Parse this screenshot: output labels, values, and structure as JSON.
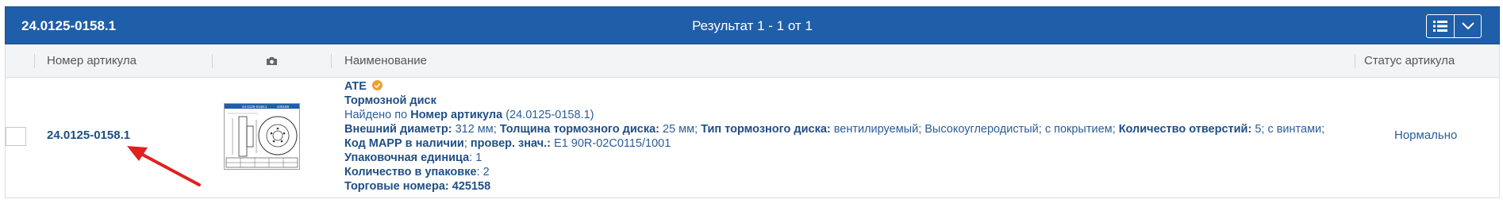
{
  "toolbar": {
    "article": "24.0125-0158.1",
    "result": "Результат 1 - 1 от 1",
    "list_view_icon": "list-icon",
    "toggle_icon": "chevron-down-icon"
  },
  "columns": {
    "article": "Номер артикула",
    "photo_icon": "camera-icon",
    "name": "Наименование",
    "status": "Статус артикула"
  },
  "row": {
    "article_number": "24.0125-0158.1",
    "brand": "ATE",
    "title": "Тормозной диск",
    "found_prefix": "Найдено по ",
    "found_key": "Номер артикула",
    "found_value": " (24.0125-0158.1)",
    "attributes": [
      {
        "label": "Внешний диаметр:",
        "value": " 312 мм; "
      },
      {
        "label": "Толщина тормозного диска:",
        "value": " 25 мм; "
      },
      {
        "label": "Тип тормозного диска:",
        "value": " вентилируемый; Высокоуглеродистый; с покрытием; "
      },
      {
        "label": "Количество отверстий:",
        "value": " 5; с винтами;"
      }
    ],
    "mapp_label": "Код МАРР в наличии",
    "check_label": "провер. знач.:",
    "check_value": " E1 90R-02C0115/1001",
    "pack_unit_label": "Упаковочная единица",
    "pack_unit_value": ": 1",
    "pack_qty_label": "Количество в упаковке",
    "pack_qty_value": ": 2",
    "trade_label": "Торговые номера: ",
    "trade_value": "425158",
    "thumb_label_left": "24.0125-0158.1",
    "thumb_label_right": "425158",
    "status": "Нормально"
  },
  "colors": {
    "header_blue": "#1f5ea8",
    "link_blue": "#1f4e85",
    "arrow_red": "#e02020",
    "verified_orange": "#f0a030"
  }
}
